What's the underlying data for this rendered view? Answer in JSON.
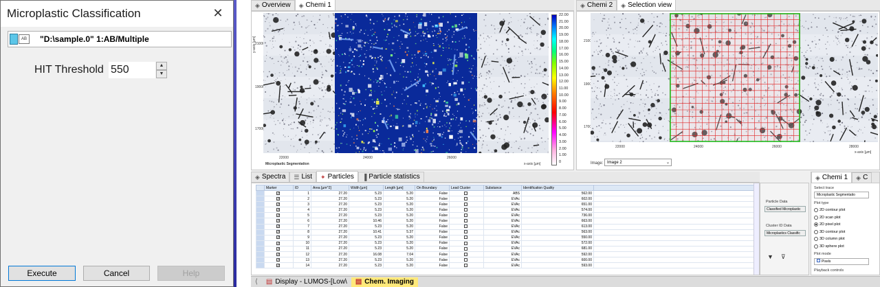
{
  "dialog": {
    "title": "Microplastic Classification",
    "source_text": "\"D:\\sample.0\" 1:AB/Multiple",
    "source_icon_label": "AB",
    "threshold_label": "HIT Threshold",
    "threshold_value": "550",
    "buttons": {
      "execute": "Execute",
      "cancel": "Cancel",
      "help": "Help"
    }
  },
  "top_left_tabs": [
    {
      "label": "Overview",
      "icon": "diamond-icon"
    },
    {
      "label": "Chemi 1",
      "icon": "diamond-icon"
    }
  ],
  "top_right_tabs": [
    {
      "label": "Chemi 2",
      "icon": "diamond-icon"
    },
    {
      "label": "Selection view",
      "icon": "diamond-icon"
    }
  ],
  "chem_pane": {
    "y_axis_label": "y-axis [µm]",
    "x_axis_label": "x-axis [µm]",
    "caption": "Microplastic Segmentation",
    "x_ticks": [
      "22000",
      "24000",
      "26000"
    ],
    "y_ticks": [
      "21000",
      "19000",
      "17000"
    ],
    "colorbar_labels": [
      "22.00",
      "21.00",
      "20.00",
      "19.00",
      "18.00",
      "17.00",
      "16.00",
      "15.00",
      "14.00",
      "13.00",
      "12.00",
      "11.00",
      "10.00",
      "9.00",
      "8.00",
      "7.00",
      "6.00",
      "5.00",
      "4.00",
      "3.00",
      "2.00",
      "1.00",
      "0"
    ],
    "colorbar_unit": "µS"
  },
  "selection_pane": {
    "y_axis_label": "y-axis [µm]",
    "x_axis_label": "x-axis [µm]",
    "x_ticks": [
      "22000",
      "24000",
      "26000",
      "28000"
    ],
    "y_ticks": [
      "21000",
      "19000",
      "17000"
    ],
    "image_label": "Image:",
    "image_select": "Image 2"
  },
  "bottom_tabs": [
    {
      "label": "Spectra",
      "icon": "spectra-icon"
    },
    {
      "label": "List",
      "icon": "list-icon"
    },
    {
      "label": "Particles",
      "icon": "particles-icon"
    },
    {
      "label": "Particle statistics",
      "icon": "statistics-icon"
    }
  ],
  "table": {
    "columns": [
      "Marker",
      "ID",
      "Area [µm^2]",
      "Width [µm]",
      "Length [µm]",
      "On Boundary",
      "Lead Cluster",
      "Substance",
      "Identification Quality"
    ],
    "rows": [
      {
        "marker": true,
        "id": "1",
        "area": "27.20",
        "width": "5.23",
        "length": "5.20",
        "boundary": "False",
        "lead": false,
        "substance": "ABS",
        "quality": "562.00"
      },
      {
        "marker": true,
        "id": "2",
        "area": "27.20",
        "width": "5.23",
        "length": "5.20",
        "boundary": "False",
        "lead": false,
        "substance": "EVAc",
        "quality": "602.00"
      },
      {
        "marker": true,
        "id": "3",
        "area": "27.20",
        "width": "5.23",
        "length": "5.20",
        "boundary": "False",
        "lead": false,
        "substance": "EVAc",
        "quality": "651.00"
      },
      {
        "marker": true,
        "id": "4",
        "area": "27.20",
        "width": "5.23",
        "length": "5.20",
        "boundary": "False",
        "lead": false,
        "substance": "EVAc",
        "quality": "574.00"
      },
      {
        "marker": true,
        "id": "5",
        "area": "27.20",
        "width": "5.23",
        "length": "5.20",
        "boundary": "False",
        "lead": false,
        "substance": "EVAc",
        "quality": "736.00"
      },
      {
        "marker": true,
        "id": "6",
        "area": "27.20",
        "width": "10.46",
        "length": "5.20",
        "boundary": "False",
        "lead": false,
        "substance": "EVAc",
        "quality": "663.00"
      },
      {
        "marker": true,
        "id": "7",
        "area": "27.20",
        "width": "5.23",
        "length": "5.20",
        "boundary": "False",
        "lead": false,
        "substance": "EVAc",
        "quality": "613.00"
      },
      {
        "marker": true,
        "id": "8",
        "area": "27.20",
        "width": "10.41",
        "length": "5.37",
        "boundary": "False",
        "lead": false,
        "substance": "EVAc",
        "quality": "563.00"
      },
      {
        "marker": true,
        "id": "9",
        "area": "27.20",
        "width": "5.23",
        "length": "5.20",
        "boundary": "False",
        "lead": false,
        "substance": "EVAc",
        "quality": "550.00"
      },
      {
        "marker": true,
        "id": "10",
        "area": "27.20",
        "width": "5.23",
        "length": "5.20",
        "boundary": "False",
        "lead": false,
        "substance": "EVAc",
        "quality": "572.00"
      },
      {
        "marker": true,
        "id": "11",
        "area": "27.20",
        "width": "5.23",
        "length": "5.20",
        "boundary": "False",
        "lead": false,
        "substance": "EVAc",
        "quality": "681.00"
      },
      {
        "marker": true,
        "id": "12",
        "area": "27.20",
        "width": "16.08",
        "length": "7.04",
        "boundary": "False",
        "lead": false,
        "substance": "EVAc",
        "quality": "592.00"
      },
      {
        "marker": true,
        "id": "13",
        "area": "27.20",
        "width": "5.23",
        "length": "5.20",
        "boundary": "False",
        "lead": false,
        "substance": "EVAc",
        "quality": "600.00"
      },
      {
        "marker": true,
        "id": "14",
        "area": "27.20",
        "width": "5.23",
        "length": "5.20",
        "boundary": "False",
        "lead": false,
        "substance": "EVAc",
        "quality": "593.00"
      }
    ]
  },
  "side_panel": {
    "particle_data_label": "Particle Data",
    "particle_data_value": "Classified Microplastic",
    "cluster_data_label": "Cluster ID Data",
    "cluster_data_value": "Microplastics Classific"
  },
  "right_panel": {
    "tabs": [
      {
        "label": "Chemi 1"
      },
      {
        "label": "C"
      }
    ],
    "select_trace_label": "Select trace",
    "select_trace_value": "Microplastic Segmentatio",
    "plot_type_label": "Plot type",
    "plot_types": [
      {
        "label": "2D contour plot",
        "selected": false
      },
      {
        "label": "2D scan plot",
        "selected": false
      },
      {
        "label": "2D pixel plot",
        "selected": true
      },
      {
        "label": "3D contour plot",
        "selected": false
      },
      {
        "label": "3D column plot",
        "selected": false
      },
      {
        "label": "3D sphere plot",
        "selected": false
      }
    ],
    "plot_mode_label": "Plot mode",
    "plot_mode_value": "Pixels",
    "playback_label": "Playback controls"
  },
  "statusbar": {
    "tabs": [
      {
        "label": "Display - LUMOS-[Low\\",
        "active": false
      },
      {
        "label": "Chem. Imaging",
        "active": true
      }
    ]
  },
  "colors": {
    "chem_background": "#0a2a9a",
    "grid_red": "#e02020",
    "grid_green": "#20c020",
    "status_active": "#ffe97a"
  }
}
